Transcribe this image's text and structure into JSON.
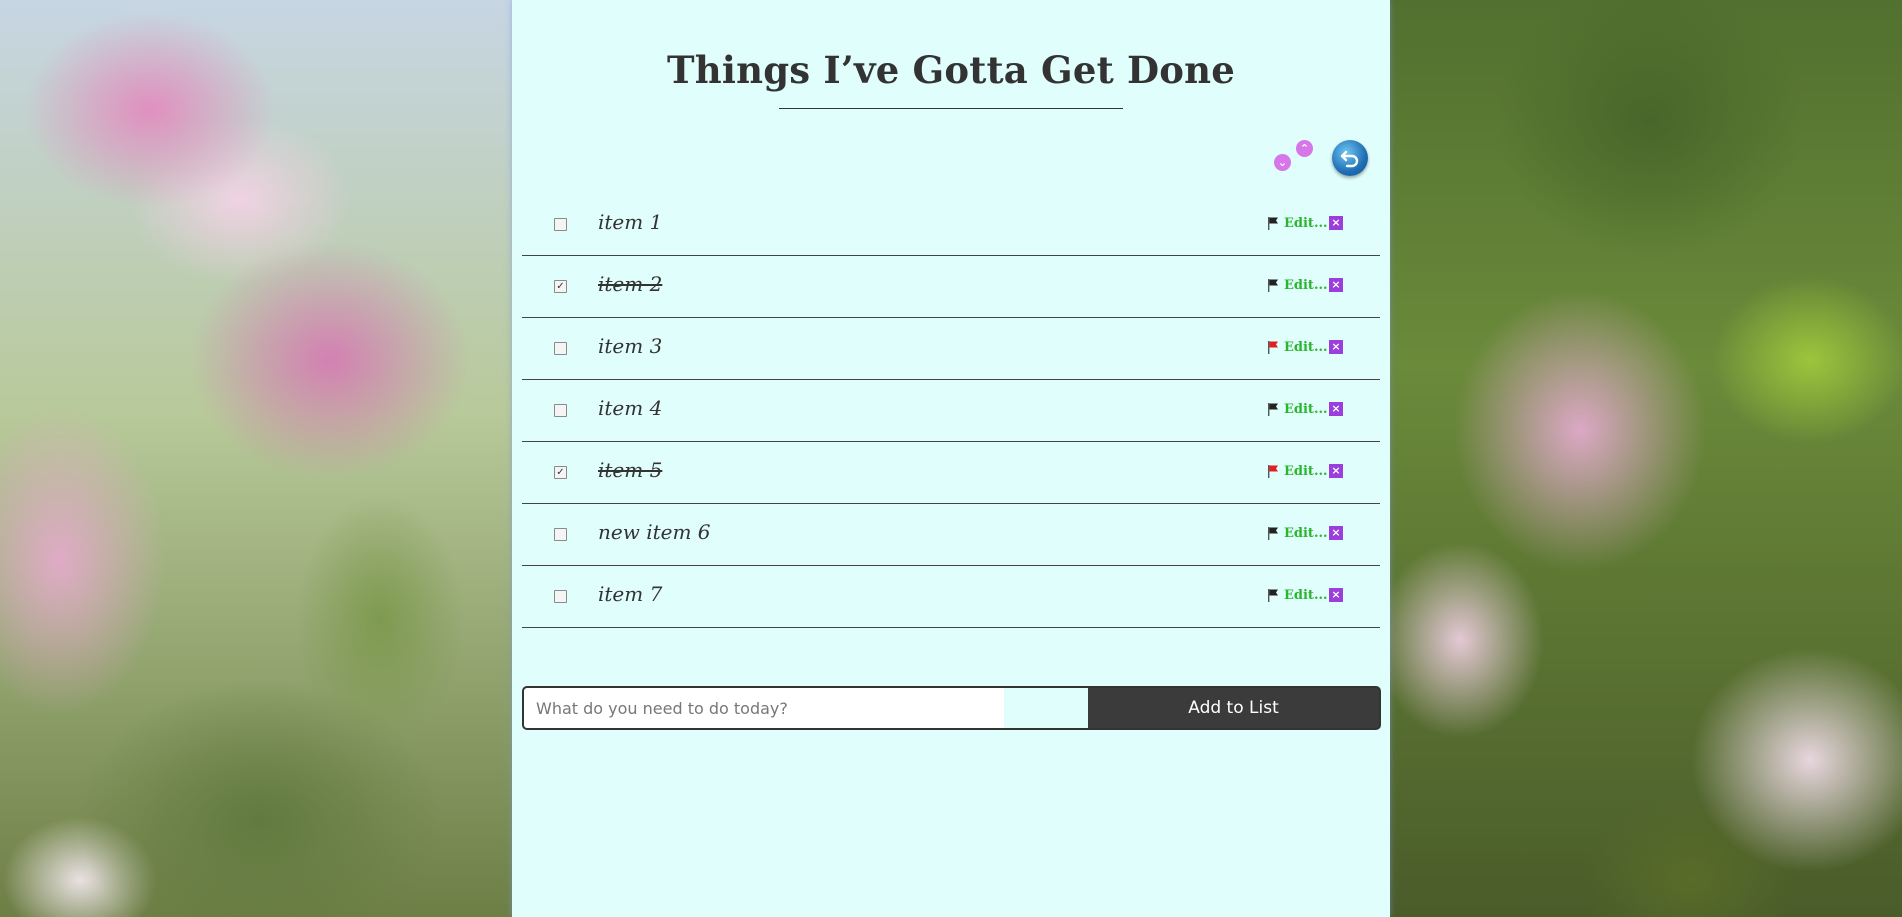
{
  "header": {
    "title": "Things I’ve Gotta Get Done"
  },
  "controls": {
    "sort_up_icon": "chevron-up-icon",
    "sort_down_icon": "chevron-down-icon",
    "undo_icon": "undo-arrow-icon"
  },
  "items": [
    {
      "label": "item 1",
      "checked": false,
      "flag": "black",
      "edit_label": "Edit...",
      "delete_label": "×"
    },
    {
      "label": "item 2",
      "checked": true,
      "flag": "black",
      "edit_label": "Edit...",
      "delete_label": "×"
    },
    {
      "label": "item 3",
      "checked": false,
      "flag": "red",
      "edit_label": "Edit...",
      "delete_label": "×"
    },
    {
      "label": "item 4",
      "checked": false,
      "flag": "black",
      "edit_label": "Edit...",
      "delete_label": "×"
    },
    {
      "label": "item 5",
      "checked": true,
      "flag": "red",
      "edit_label": "Edit...",
      "delete_label": "×"
    },
    {
      "label": "new item 6",
      "checked": false,
      "flag": "black",
      "edit_label": "Edit...",
      "delete_label": "×"
    },
    {
      "label": "item 7",
      "checked": false,
      "flag": "black",
      "edit_label": "Edit...",
      "delete_label": "×"
    }
  ],
  "form": {
    "placeholder": "What do you need to do today?",
    "value": "",
    "button_label": "Add to List"
  },
  "colors": {
    "panel_bg": "#e0fefc",
    "edit_green": "#2bb52e",
    "delete_purple": "#9b3fdc",
    "flag_red": "#e02020",
    "flag_black": "#222222",
    "sort_pink": "#d676e8"
  }
}
